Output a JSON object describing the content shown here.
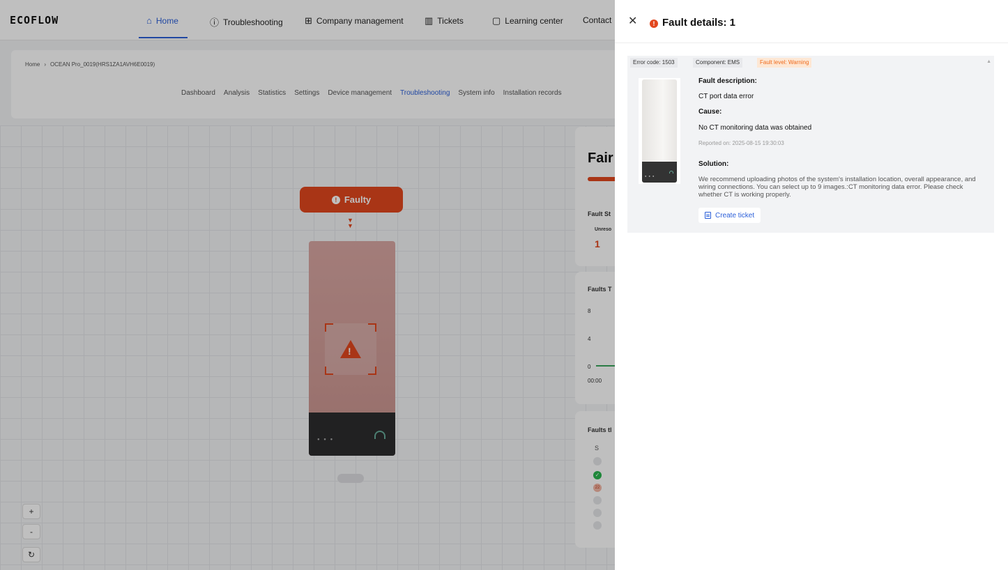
{
  "app": {
    "logo": "ECOFLOW",
    "nav": [
      {
        "label": "Home",
        "icon": "house-icon"
      },
      {
        "label": "Troubleshooting",
        "icon": "alert-circle-icon"
      },
      {
        "label": "Company management",
        "icon": "grid-icon"
      },
      {
        "label": "Tickets",
        "icon": "bar-chart-icon"
      },
      {
        "label": "Learning center",
        "icon": "bookmark-icon"
      },
      {
        "label": "Contact"
      }
    ],
    "breadcrumb": [
      "Home",
      "OCEAN Pro_0019(HRS1ZA1AVH6E0019)"
    ],
    "tabs": [
      "Dashboard",
      "Analysis",
      "Statistics",
      "Settings",
      "Device management",
      "Troubleshooting",
      "System info",
      "Installation records"
    ],
    "active_tab": "Troubleshooting",
    "faulty_label": "Faulty",
    "zoom": {
      "plus": "+",
      "minus": "-",
      "reset": "↻"
    },
    "health_title": "Fair",
    "fault_stats_label": "Fault St",
    "unresolved_label": "Unreso",
    "unresolved_count": "1",
    "faults_trend_label": "Faults T",
    "trend_y": [
      "8",
      "4",
      "0"
    ],
    "trend_x": "00:00",
    "faults_list_label": "Faults tl",
    "list_col": "S",
    "list_badge": "22"
  },
  "drawer": {
    "title": "Fault details: 1",
    "tags": {
      "error_code": "Error code: 1503",
      "component": "Component: EMS",
      "fault_level": "Fault level: Warning"
    },
    "fault_description_label": "Fault description:",
    "fault_description": "CT port data error",
    "cause_label": "Cause:",
    "cause": "No CT monitoring data was obtained",
    "reported_on": "Reported on: 2025-08-15 19:30:03",
    "solution_label": "Solution:",
    "solution": "We recommend uploading photos of the system's installation location, overall appearance, and wiring connections. You can select up to 9 images.:CT monitoring data error. Please check whether CT is working properly.",
    "create_ticket_label": "Create ticket"
  },
  "colors": {
    "accent": "#2b5fd9",
    "fault": "#e2471e",
    "warning": "#ef6b1d"
  }
}
